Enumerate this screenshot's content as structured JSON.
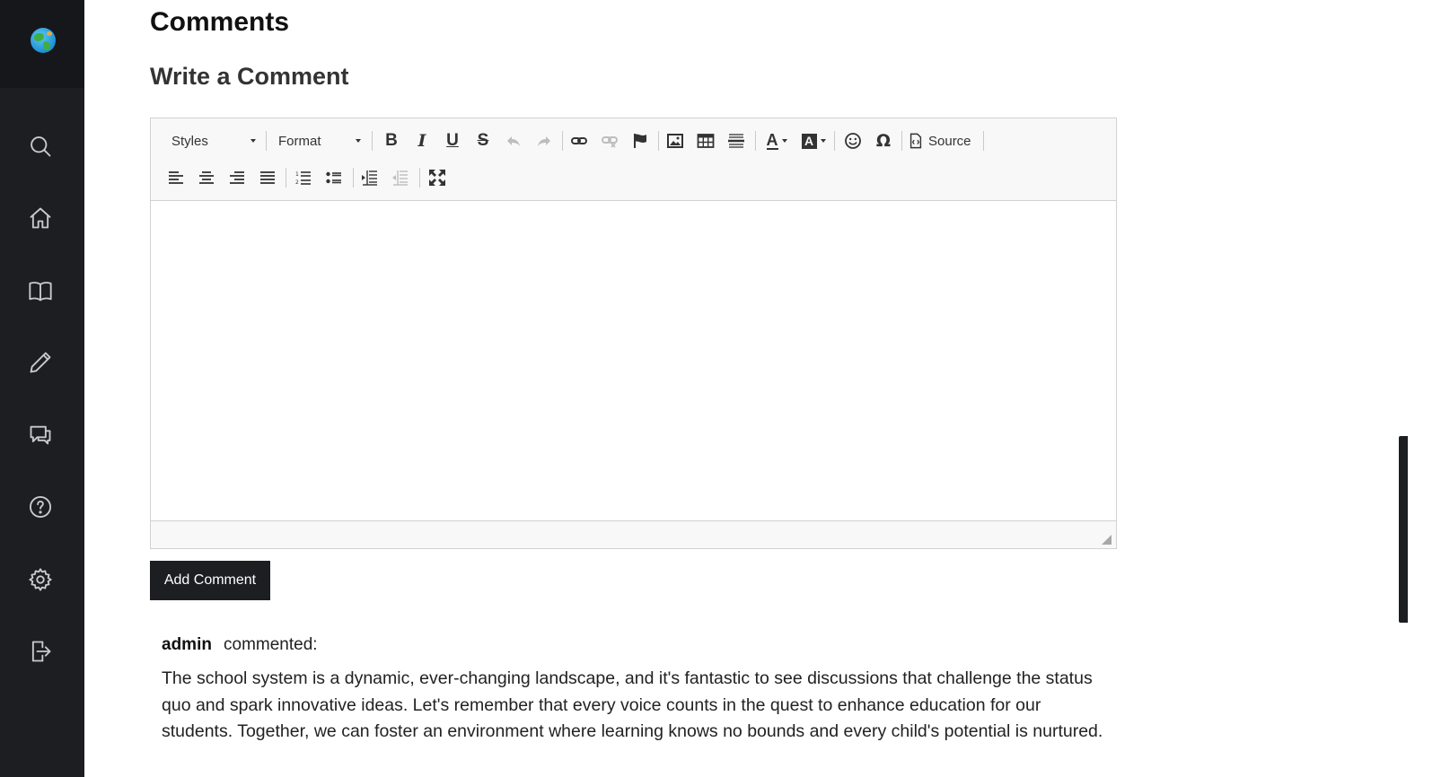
{
  "sidebar": {
    "logo_icon": "globe-icon",
    "items": [
      {
        "name": "search",
        "icon": "search-icon"
      },
      {
        "name": "home",
        "icon": "home-icon"
      },
      {
        "name": "library",
        "icon": "book-icon"
      },
      {
        "name": "write",
        "icon": "pencil-icon"
      },
      {
        "name": "messages",
        "icon": "chat-icon"
      },
      {
        "name": "help",
        "icon": "help-icon"
      },
      {
        "name": "settings",
        "icon": "gear-icon"
      },
      {
        "name": "logout",
        "icon": "logout-icon"
      }
    ],
    "background": "#1d1e22"
  },
  "page": {
    "title": "Comments",
    "subtitle": "Write a Comment"
  },
  "editor": {
    "styles_label": "Styles",
    "format_label": "Format",
    "source_label": "Source",
    "text_color_glyph": "A",
    "bg_color_glyph": "A",
    "special_char_glyph": "Ω",
    "bold_glyph": "B",
    "italic_glyph": "I",
    "underline_glyph": "U",
    "strike_glyph": "S",
    "content": ""
  },
  "add_comment_label": "Add Comment",
  "comments": [
    {
      "author": "admin",
      "verb": "commented:",
      "text": "The school system is a dynamic, ever-changing landscape, and it's fantastic to see discussions that challenge the status quo and spark innovative ideas. Let's remember that every voice counts in the quest to enhance education for our students. Together, we can foster an environment where learning knows no bounds and every child's potential is nurtured."
    }
  ],
  "colors": {
    "dark": "#1d1e22",
    "toolbar_bg": "#f8f8f8",
    "border": "#d1d1d1"
  }
}
